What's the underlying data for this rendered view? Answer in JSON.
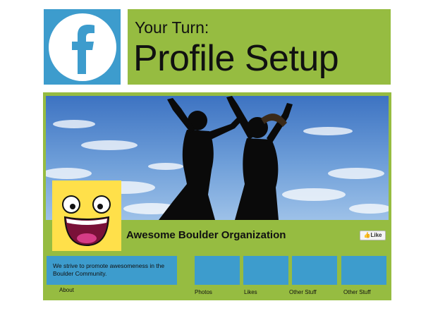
{
  "header": {
    "icon": "facebook-f-icon",
    "subtitle": "Your Turn:",
    "title": "Profile Setup"
  },
  "profile": {
    "cover_image": "silhouettes-jumping-sky",
    "avatar": "awesome-face-emoji",
    "org_name": "Awesome Boulder Organization",
    "like_label": "Like",
    "about_text": "We strive to promote awesomeness in the Boulder Community.",
    "about_label": "About",
    "tiles": [
      "Photos",
      "Likes",
      "Other Stuff",
      "Other Stuff"
    ]
  },
  "colors": {
    "facebook_blue": "#3d9ccd",
    "green": "#96bc41"
  }
}
